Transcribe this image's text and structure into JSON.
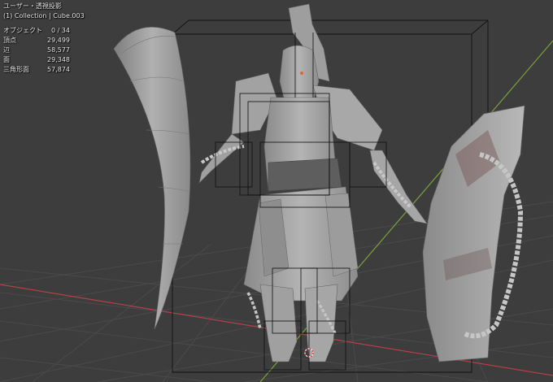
{
  "viewport": {
    "view_mode": "ユーザー・透視投影",
    "collection_info": "(1) Collection | Cube.003",
    "stats": [
      {
        "label": "オブジェクト",
        "value": "0 / 34"
      },
      {
        "label": "頂点",
        "value": "29,499"
      },
      {
        "label": "辺",
        "value": "58,577"
      },
      {
        "label": "面",
        "value": "29,348"
      },
      {
        "label": "三角形面",
        "value": "57,874"
      }
    ]
  },
  "colors": {
    "background": "#3d3d3d",
    "grid": "#4a4a4a",
    "x_axis": "#b3404a",
    "y_axis": "#7aa238",
    "wireframe": "#000000",
    "mesh": "#9a9a9a",
    "origin_marker": "#e8603c"
  }
}
